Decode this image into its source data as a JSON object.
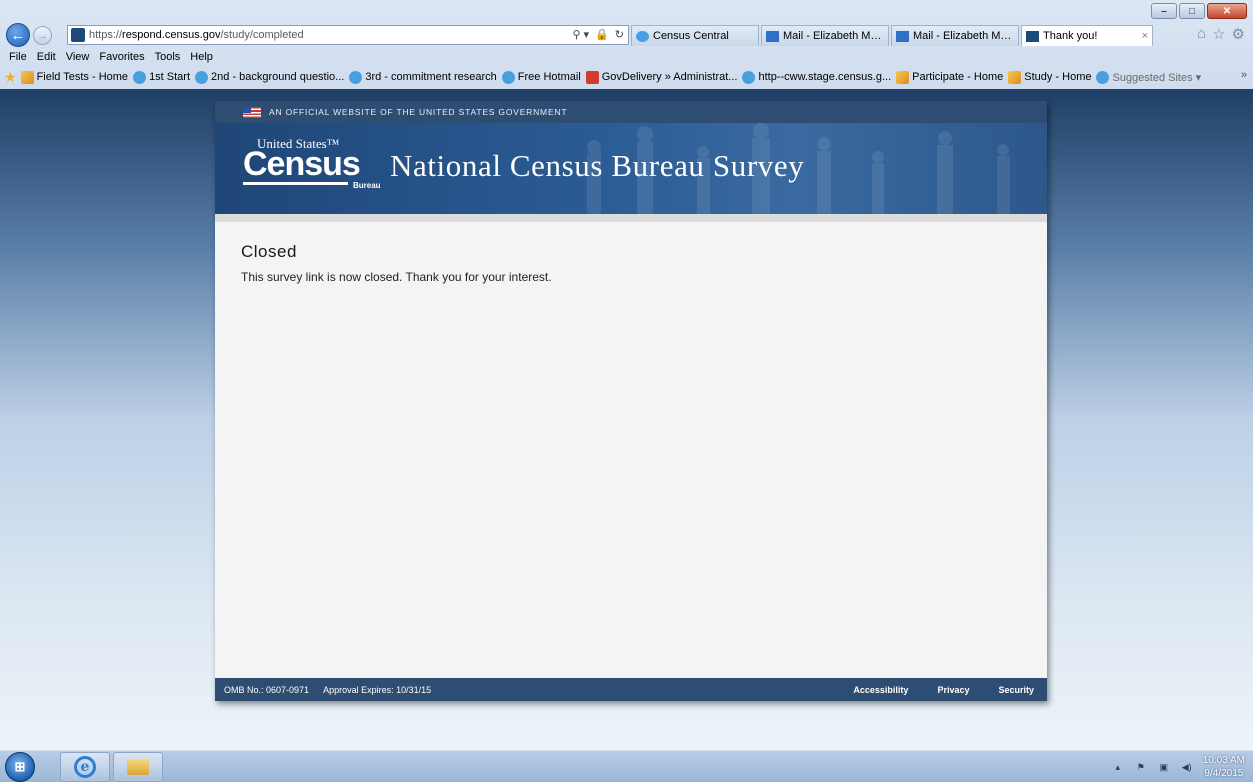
{
  "window": {
    "minimize": "–",
    "maximize": "□",
    "close": "✕"
  },
  "nav": {
    "back_glyph": "←",
    "forward_glyph": "→",
    "url_scheme": "https://",
    "url_host": "respond.census.gov",
    "url_path": "/study/completed",
    "addr_tools": [
      "⚲ ▾",
      "🔒",
      "↻"
    ]
  },
  "tabs": [
    {
      "label": "Census Central",
      "icon": "ie-icon",
      "active": false
    },
    {
      "label": "Mail - Elizabeth May ...",
      "icon": "mail-icon",
      "active": false
    },
    {
      "label": "Mail - Elizabeth May ...",
      "icon": "mail-icon",
      "active": false
    },
    {
      "label": "Thank you!",
      "icon": "census-icon",
      "active": true,
      "close": "×"
    }
  ],
  "toolbar_icons": {
    "home": "⌂",
    "favorites": "☆",
    "settings": "⚙"
  },
  "menu": [
    "File",
    "Edit",
    "View",
    "Favorites",
    "Tools",
    "Help"
  ],
  "favorites": [
    {
      "label": "Field Tests - Home",
      "icon": "grid"
    },
    {
      "label": "1st Start",
      "icon": "ie"
    },
    {
      "label": "2nd - background questio...",
      "icon": "ie"
    },
    {
      "label": "3rd - commitment research",
      "icon": "ie"
    },
    {
      "label": "Free Hotmail",
      "icon": "ie"
    },
    {
      "label": "GovDelivery » Administrat...",
      "icon": "red"
    },
    {
      "label": "http--cww.stage.census.g...",
      "icon": "ie"
    },
    {
      "label": "Participate - Home",
      "icon": "grid"
    },
    {
      "label": "Study - Home",
      "icon": "grid"
    },
    {
      "label": "Suggested Sites ▾",
      "icon": "ie",
      "muted": true
    }
  ],
  "favorites_more": "»",
  "page": {
    "gov_banner": "AN OFFICIAL WEBSITE OF THE UNITED STATES GOVERNMENT",
    "logo": {
      "top": "United States™",
      "main": "Census",
      "bottom": "Bureau"
    },
    "title": "National Census Bureau Survey",
    "heading": "Closed",
    "message": "This survey link is now closed. Thank you for your interest.",
    "footer": {
      "omb": "OMB No.: 0607-0971",
      "approval": "Approval Expires: 10/31/15",
      "links": [
        "Accessibility",
        "Privacy",
        "Security"
      ]
    }
  },
  "taskbar": {
    "start_glyph": "⊞",
    "ie_glyph": "e",
    "tray": [
      "▴",
      "⚑",
      "▣",
      "◀)"
    ],
    "time": "10:03 AM",
    "date": "9/4/2015"
  },
  "colors": {
    "header_blue": "#2d4d73",
    "banner_blue": "#2b5b94",
    "page_bg": "#f4f4f4"
  }
}
